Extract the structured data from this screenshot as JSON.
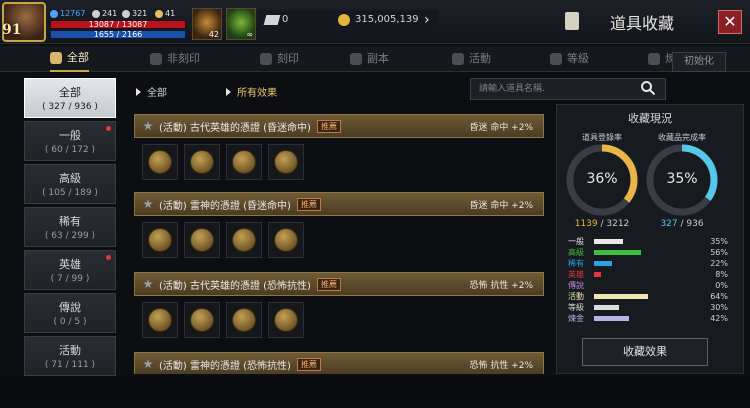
{
  "hud": {
    "level": "91",
    "stats": [
      {
        "icon": "power-icon",
        "value": "12767",
        "color": "#4fa3ff"
      },
      {
        "icon": "attack-icon",
        "value": "241",
        "color": "#d6d6d6"
      },
      {
        "icon": "defense-icon",
        "value": "321",
        "color": "#d6d6d6"
      },
      {
        "icon": "trophy-icon",
        "value": "41",
        "color": "#d6d6d6"
      }
    ],
    "hp": "13087 / 13087",
    "mp": "1655 / 2166",
    "slot1_count": "42",
    "slot2_label": "∞",
    "gems": "0",
    "gold": "315,005,139"
  },
  "page_title": "道具收藏",
  "tabs": [
    {
      "label": "全部",
      "active": true
    },
    {
      "label": "非刻印"
    },
    {
      "label": "刻印"
    },
    {
      "label": "副本"
    },
    {
      "label": "活動"
    },
    {
      "label": "等級"
    },
    {
      "label": "煉金"
    }
  ],
  "reset_label": "初始化",
  "categories": [
    {
      "name": "全部",
      "count": "( 327 / 936 )",
      "active": true
    },
    {
      "name": "一般",
      "count": "( 60 / 172 )",
      "dot": true
    },
    {
      "name": "高級",
      "count": "( 105 / 189 )"
    },
    {
      "name": "稀有",
      "count": "( 63 / 299 )"
    },
    {
      "name": "英雄",
      "count": "( 7 / 99 )",
      "dot": true
    },
    {
      "name": "傳說",
      "count": "( 0 / 5 )"
    },
    {
      "name": "活動",
      "count": "( 71 / 111 )"
    }
  ],
  "filters": {
    "first": "全部",
    "second": "所有效果"
  },
  "search": {
    "placeholder": "請輸入道具名稱."
  },
  "collections": [
    {
      "title": "(活動) 古代英雄的憑證 (昏迷命中)",
      "badge": "推薦",
      "effect": "昏迷 命中 +2%"
    },
    {
      "title": "(活動) 雷神的憑證 (昏迷命中)",
      "badge": "推薦",
      "effect": "昏迷 命中 +2%"
    },
    {
      "title": "(活動) 古代英雄的憑證 (恐怖抗性)",
      "badge": "推薦",
      "effect": "恐怖 抗性 +2%"
    },
    {
      "title": "(活動) 雷神的憑證 (恐怖抗性)",
      "badge": "推薦",
      "effect": "恐怖 抗性 +2%"
    }
  ],
  "status": {
    "title": "收藏現況",
    "left_label": "道具登錄率",
    "left_value": "36%",
    "left_fraction": 0.36,
    "left_current": "1139",
    "left_total": " / 3212",
    "right_label": "收藏品完成率",
    "right_value": "35%",
    "right_fraction": 0.35,
    "right_current": "327",
    "right_total": " / 936",
    "rows": [
      {
        "name": "一般",
        "pct": "35%",
        "fraction": 0.35,
        "color": "#e8e8e8"
      },
      {
        "name": "高級",
        "pct": "56%",
        "fraction": 0.56,
        "color": "#3fbf3f"
      },
      {
        "name": "稀有",
        "pct": "22%",
        "fraction": 0.22,
        "color": "#2aa3e0"
      },
      {
        "name": "英雄",
        "pct": "8%",
        "fraction": 0.08,
        "color": "#e03a3a"
      },
      {
        "name": "傳說",
        "pct": "0%",
        "fraction": 0.0,
        "color": "#c48ae0"
      },
      {
        "name": "活動",
        "pct": "64%",
        "fraction": 0.64,
        "color": "#efe6b0"
      },
      {
        "name": "等級",
        "pct": "30%",
        "fraction": 0.3,
        "color": "#dcdcdc"
      },
      {
        "name": "煉金",
        "pct": "42%",
        "fraction": 0.42,
        "color": "#b8b2e6"
      }
    ],
    "button": "收藏效果"
  }
}
